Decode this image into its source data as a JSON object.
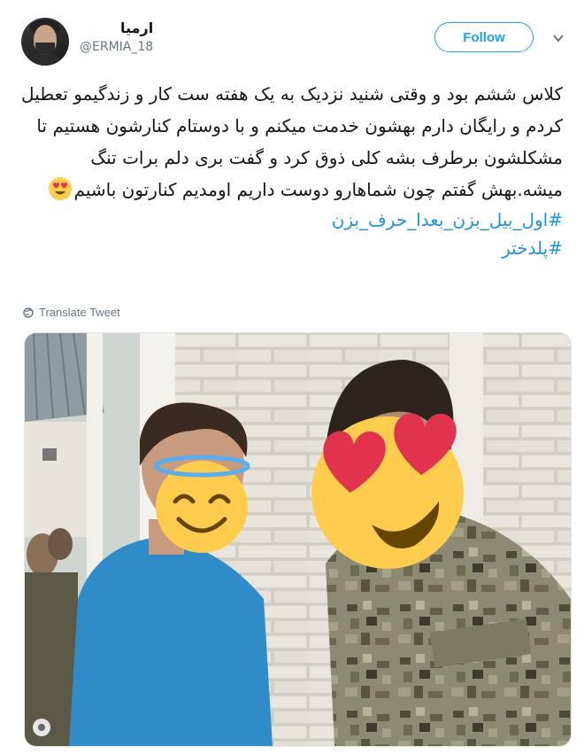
{
  "user": {
    "display_name": "ارمیا",
    "handle": "@ERMIA_18"
  },
  "follow_label": "Follow",
  "tweet": {
    "text": "کلاس ششم بود و وقتی شنید نزدیک به یک هفته ست کار و زندگیمو تعطیل کردم و رایگان دارم بهشون خدمت میکنم و با دوستام کنارشون هستیم تا مشکلشون برطرف بشه کلی ذوق کرد و گفت بری دلم برات تنگ میشه.بهش گفتم چون شماهارو دوست داریم اومدیم کنارتون باشیم",
    "emoji": "heart-eyes-face",
    "hashtags": [
      "#اول_بیل_بزن_بعدا_حرف_بزن",
      "#پلدختر"
    ]
  },
  "translate_label": "Translate Tweet",
  "colors": {
    "accent": "#1da1f2",
    "hashtag": "#1b95e0",
    "secondary_text": "#657786"
  }
}
